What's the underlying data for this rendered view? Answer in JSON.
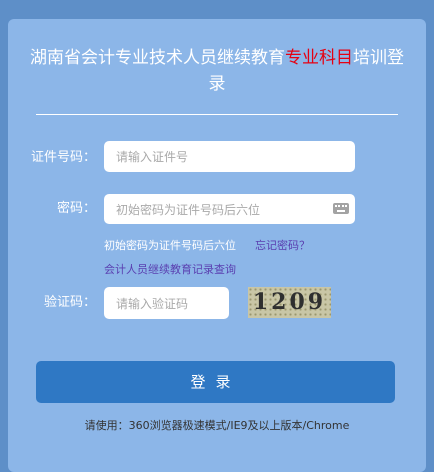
{
  "title": {
    "prefix": "湖南省会计专业技术人员继续教育",
    "highlight": "专业科目",
    "suffix": "培训登录"
  },
  "fields": {
    "id_label": "证件号码：",
    "id_placeholder": "请输入证件号",
    "password_label": "密码：",
    "password_placeholder": "初始密码为证件号码后六位",
    "captcha_label": "验证码：",
    "captcha_placeholder": "请输入验证码"
  },
  "hint_text": "初始密码为证件号码后六位",
  "forgot_link": "忘记密码？",
  "records_link": "会计人员继续教育记录查询",
  "captcha_value": "1209",
  "login_button": "登录",
  "footer_text": "请使用：360浏览器极速模式/IE9及以上版本/Chrome",
  "colors": {
    "page_bg": "#5e8fc8",
    "card_bg": "#8cb6e8",
    "title_highlight": "#e60012",
    "button_bg": "#2f78c4",
    "link": "#5a3fb0"
  },
  "icons": {
    "password_field": "keyboard-icon"
  }
}
